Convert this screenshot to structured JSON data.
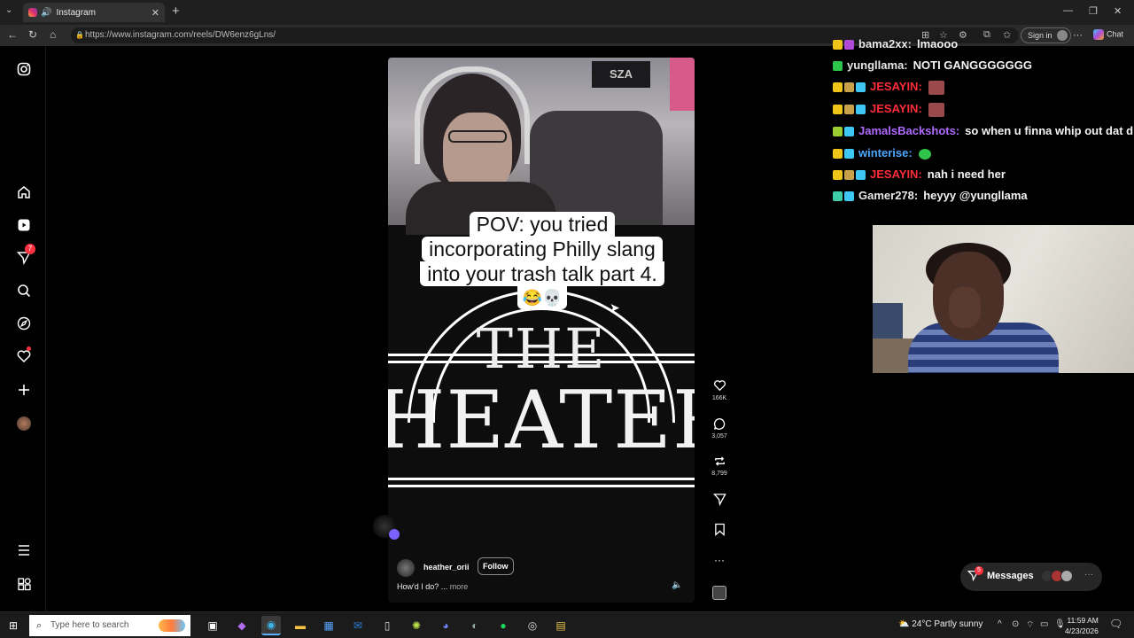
{
  "browser": {
    "tab_title": "Instagram",
    "url": "https://www.instagram.com/reels/DW6enz6gLns/",
    "signin_label": "Sign in",
    "chat_label": "Chat"
  },
  "sidebar": {
    "notification_count": "7",
    "items": [
      "instagram-logo",
      "home",
      "reels",
      "messages",
      "search",
      "explore",
      "notifications",
      "create",
      "profile",
      "more",
      "also-from-meta"
    ]
  },
  "reel": {
    "caption_lines": [
      "POV: you tried",
      "incorporating Philly slang",
      "into your trash talk part 4."
    ],
    "caption_emoji": "😂💀",
    "sign_top": "THE",
    "sign_main": "HEATER",
    "webcam_poster_text": "SZA",
    "username": "heather_orii",
    "follow_label": "Follow",
    "description": "How'd I do? ...",
    "more_label": "more",
    "likes": "166K",
    "comments": "3,057",
    "reposts": "8,799"
  },
  "stream_chat": [
    {
      "user": "bama2xx",
      "message": "lmaooo",
      "color": "#e8e8e8",
      "badges": [
        "#f0c419",
        "#b04bd8"
      ]
    },
    {
      "user": "yungllama",
      "message": "NOTI GANGGGGGGG",
      "color": "#e8e8e8",
      "badges": [
        "#2ec44a"
      ]
    },
    {
      "user": "JESAYIN",
      "message": "",
      "color": "#ff2d3a",
      "badges": [
        "#f0c419",
        "#c8a24a",
        "#3ec7f2"
      ],
      "emote": "red"
    },
    {
      "user": "JESAYIN",
      "message": "",
      "color": "#ff2d3a",
      "badges": [
        "#f0c419",
        "#c8a24a",
        "#3ec7f2"
      ],
      "emote": "red"
    },
    {
      "user": "JamalsBackshots",
      "message": "so when u finna whip out dat di",
      "color": "#b06aff",
      "badges": [
        "#9acd32",
        "#3ec7f2"
      ]
    },
    {
      "user": "winterise",
      "message": "",
      "color": "#4aa8ff",
      "badges": [
        "#f0c419",
        "#3ec7f2"
      ],
      "emote": "green"
    },
    {
      "user": "JESAYIN",
      "message": "nah i need her",
      "color": "#ff2d3a",
      "badges": [
        "#f0c419",
        "#c8a24a",
        "#3ec7f2"
      ]
    },
    {
      "user": "Gamer278",
      "message": "heyyy @yungllama",
      "color": "#e8e8e8",
      "badges": [
        "#3ecfa8",
        "#3ec7f2"
      ]
    }
  ],
  "messages_pill": {
    "label": "Messages",
    "badge": "5"
  },
  "taskbar": {
    "search_placeholder": "Type here to search",
    "weather": "24°C  Partly sunny",
    "time": "11:59 AM",
    "date": "4/23/2026"
  }
}
